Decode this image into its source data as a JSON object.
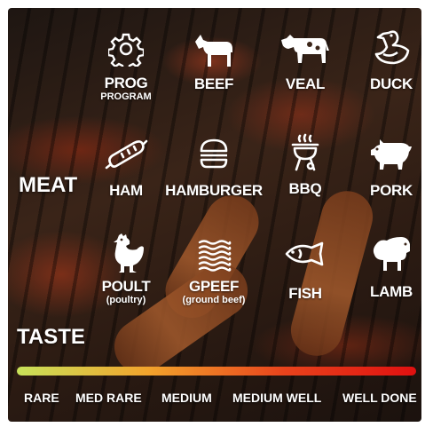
{
  "section_labels": {
    "meat": "MEAT",
    "taste": "TASTE"
  },
  "meats": [
    {
      "label": "PROG",
      "sub": "PROGRAM",
      "icon": "gear-icon"
    },
    {
      "label": "BEEF",
      "icon": "goat-icon"
    },
    {
      "label": "VEAL",
      "icon": "cow-icon"
    },
    {
      "label": "DUCK",
      "icon": "duck-icon"
    },
    {
      "label": "HAM",
      "icon": "sausage-icon"
    },
    {
      "label": "HAMBURGER",
      "icon": "hamburger-icon"
    },
    {
      "label": "BBQ",
      "icon": "grill-icon"
    },
    {
      "label": "PORK",
      "icon": "pig-icon"
    },
    {
      "label": "POULT",
      "sub": "(poultry)",
      "icon": "chicken-icon"
    },
    {
      "label": "GPEEF",
      "sub": "(ground beef)",
      "icon": "ground-meat-icon"
    },
    {
      "label": "FISH",
      "icon": "fish-icon"
    },
    {
      "label": "LAMB",
      "icon": "sheep-icon"
    }
  ],
  "taste_levels": [
    "RARE",
    "MED RARE",
    "MEDIUM",
    "MEDIUM WELL",
    "WELL DONE"
  ],
  "taste_gradient": [
    "#c8e25a",
    "#f2a32c",
    "#e8431c",
    "#e01010"
  ]
}
